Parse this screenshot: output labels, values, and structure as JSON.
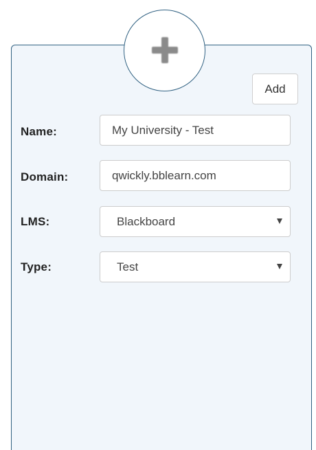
{
  "add_button_label": "Add",
  "form": {
    "name": {
      "label": "Name:",
      "value": "My University - Test"
    },
    "domain": {
      "label": "Domain:",
      "value": "qwickly.bblearn.com"
    },
    "lms": {
      "label": "LMS:",
      "value": "Blackboard"
    },
    "type": {
      "label": "Type:",
      "value": "Test"
    }
  },
  "icons": {
    "add": "plus-icon",
    "dropdown": "chevron-down-icon"
  },
  "colors": {
    "border": "#2e5f80",
    "card_background": "#f1f6fb"
  }
}
